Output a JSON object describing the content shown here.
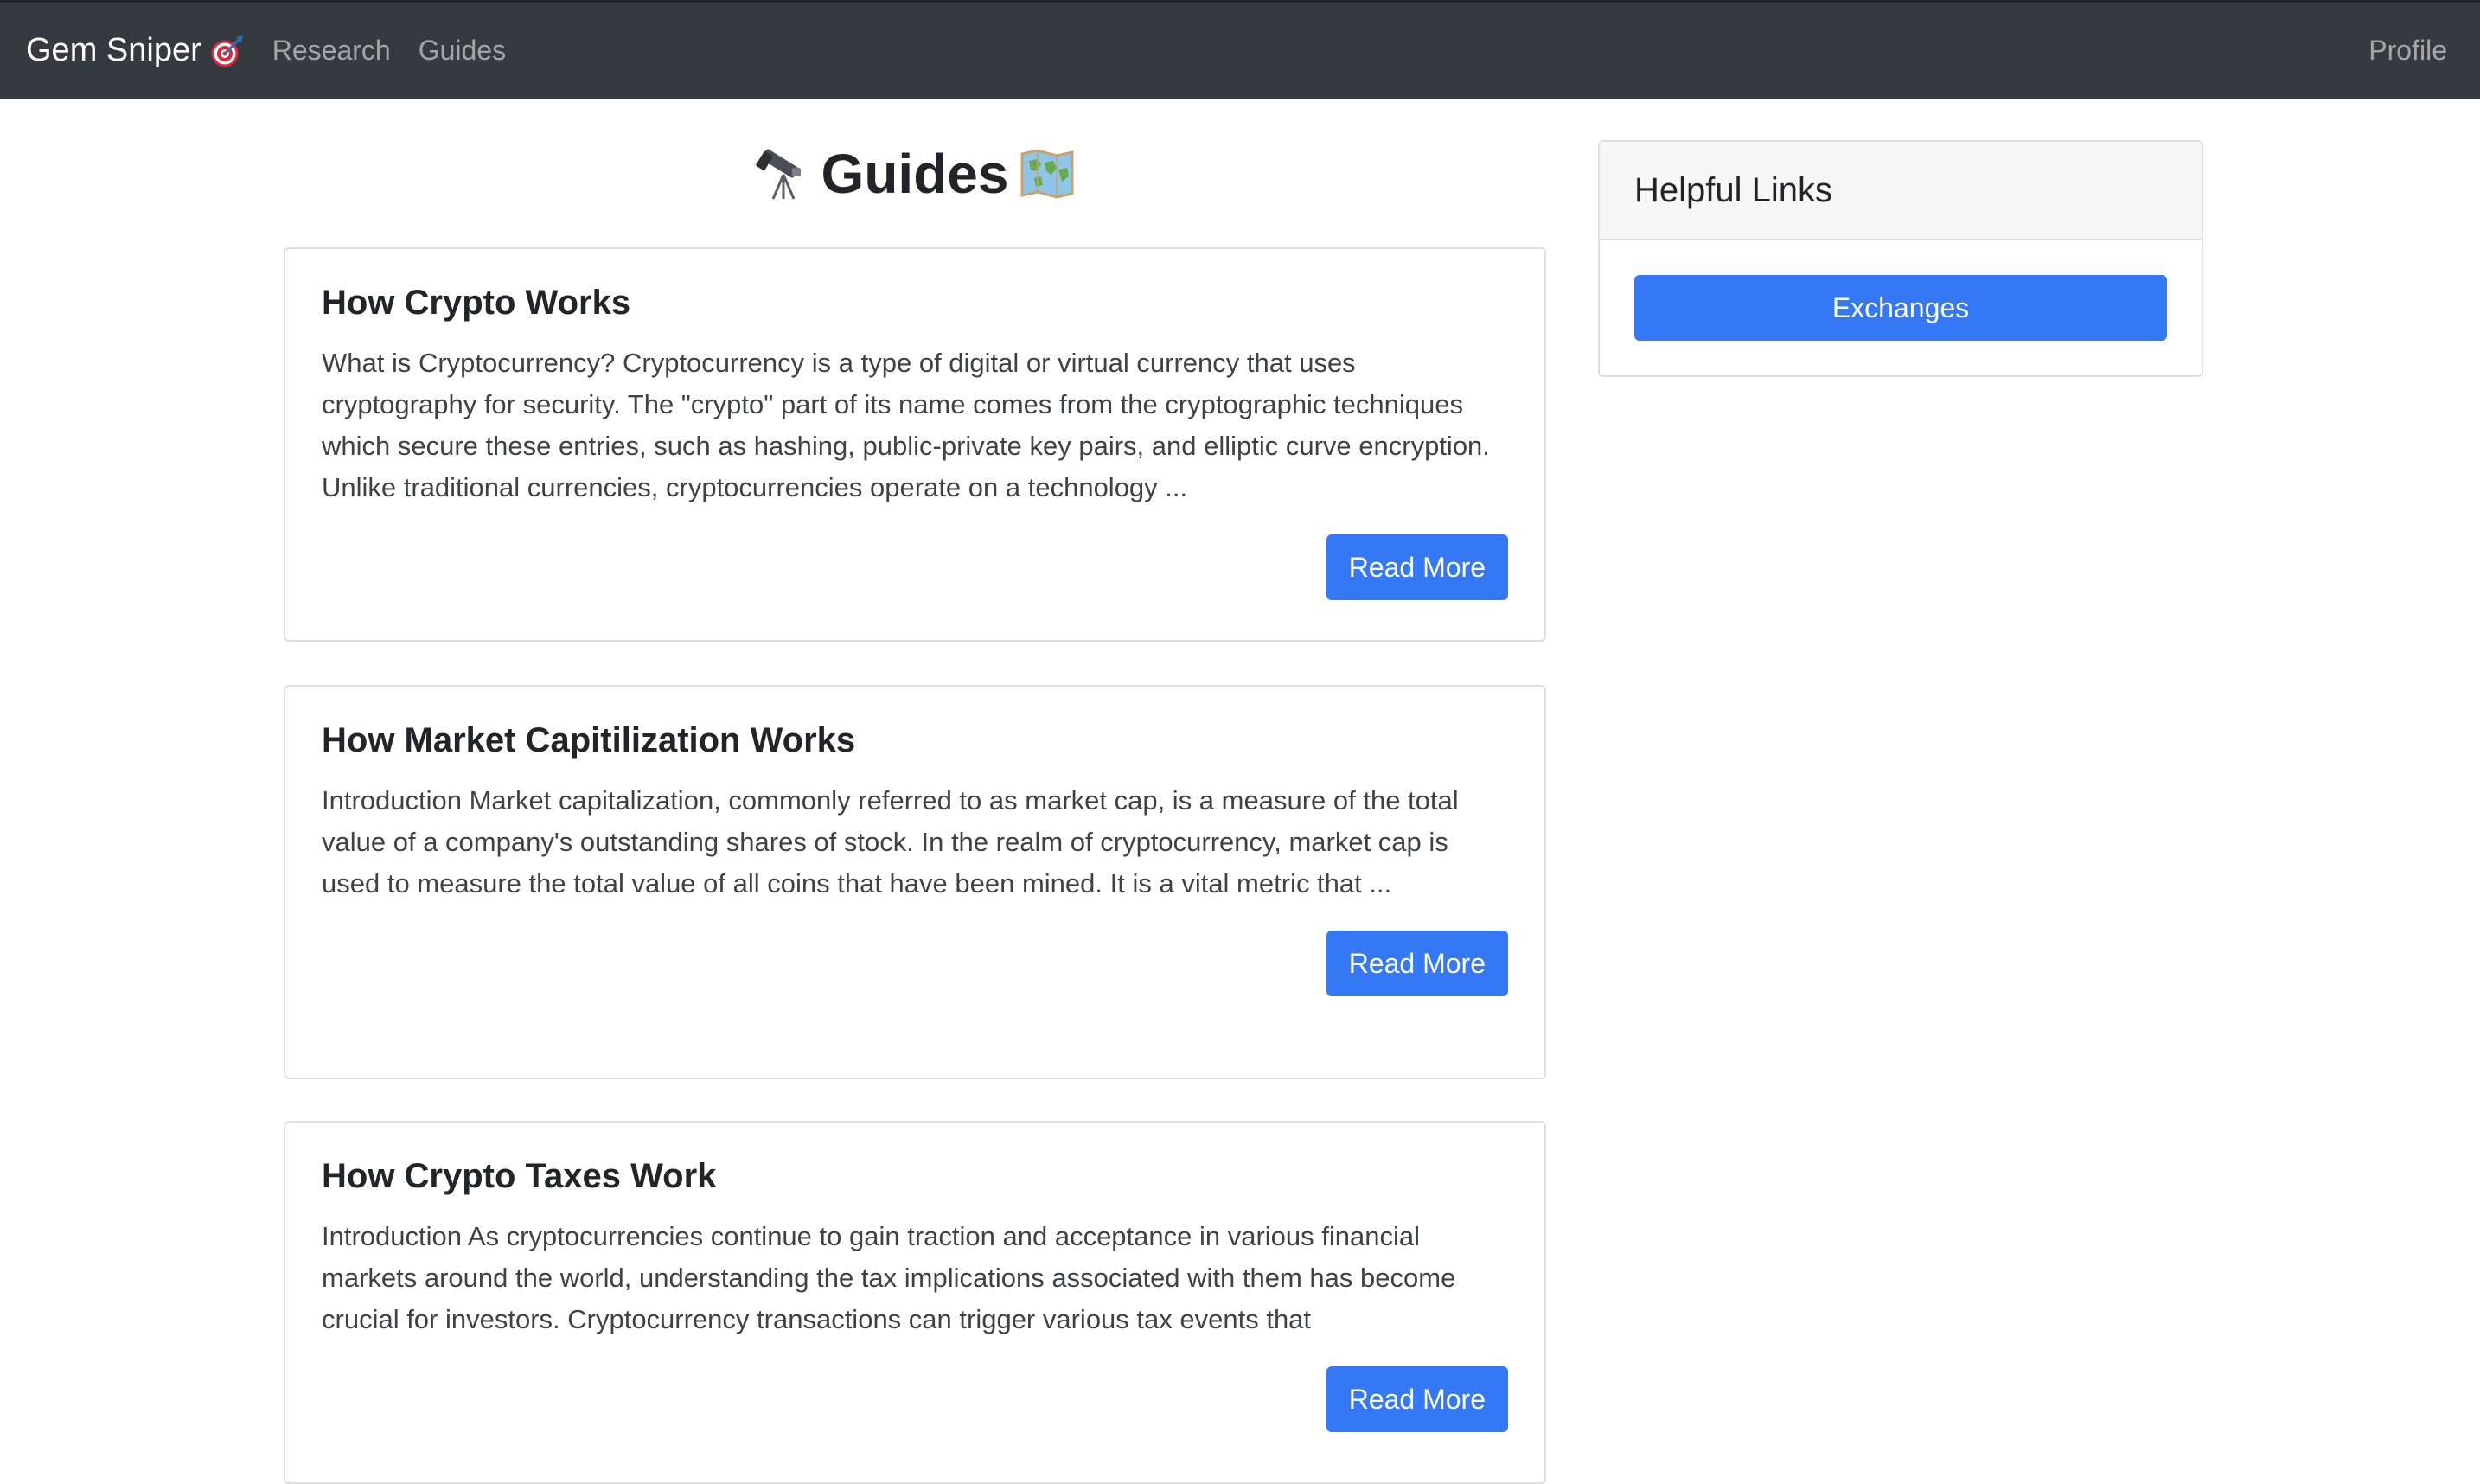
{
  "navbar": {
    "brand": "Gem Sniper",
    "brand_icon": "dart-target-icon",
    "links": [
      "Research",
      "Guides"
    ],
    "profile": "Profile"
  },
  "page": {
    "title": "Guides",
    "title_icon_left": "telescope-icon",
    "title_icon_right": "world-map-icon"
  },
  "guides": [
    {
      "title": "How Crypto Works",
      "excerpt": "What is Cryptocurrency? Cryptocurrency is a type of digital or virtual currency that uses cryptography for security. The \"crypto\" part of its name comes from the cryptographic techniques which secure these entries, such as hashing, public-private key pairs, and elliptic curve encryption. Unlike traditional currencies, cryptocurrencies operate on a technology ...",
      "button": "Read More"
    },
    {
      "title": "How Market Capitilization Works",
      "excerpt": "Introduction Market capitalization, commonly referred to as market cap, is a measure of the total value of a company's outstanding shares of stock. In the realm of cryptocurrency, market cap is used to measure the total value of all coins that have been mined. It is a vital metric that ...",
      "button": "Read More"
    },
    {
      "title": "How Crypto Taxes Work",
      "excerpt": "Introduction As cryptocurrencies continue to gain traction and acceptance in various financial markets around the world, understanding the tax implications associated with them has become crucial for investors. Cryptocurrency transactions can trigger various tax events that",
      "button": "Read More"
    }
  ],
  "sidebar": {
    "header": "Helpful Links",
    "button": "Exchanges"
  },
  "colors": {
    "navbar_bg": "#343a40",
    "primary": "#3478f6",
    "card_border": "#dfdfdf"
  }
}
